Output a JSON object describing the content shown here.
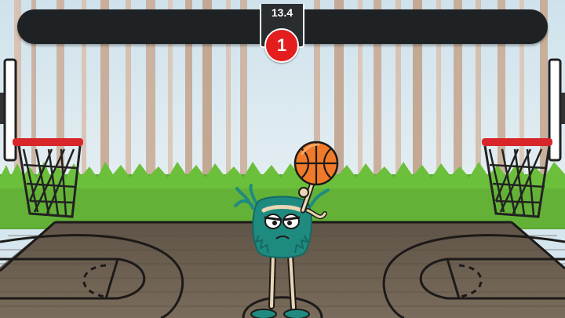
{
  "hud": {
    "timer": "13.4",
    "score": "1"
  },
  "scene": {
    "ball_icon": "basketball-icon",
    "player": "teal-fuzzy-monster-character",
    "left_hoop": "basketball-hoop-left",
    "right_hoop": "basketball-hoop-right"
  },
  "colors": {
    "sky": "#d6e6ef",
    "grass": "#5aa82f",
    "court_wood": "#6e6152",
    "court_line": "#1c1a18",
    "hud_bar": "#1f2224",
    "score_badge": "#e41e1e",
    "ball": "#f07a2a",
    "player_fur": "#1f8a80",
    "rim": "#d8262b"
  }
}
